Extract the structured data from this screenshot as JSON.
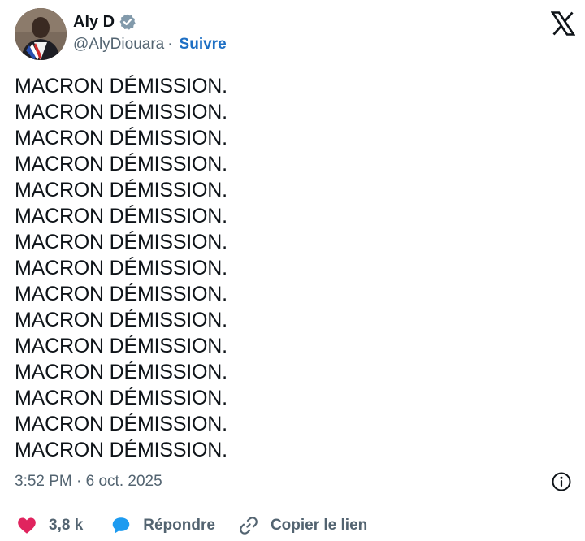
{
  "author": {
    "display_name": "Aly D",
    "handle": "@AlyDiouara",
    "separator": "·",
    "follow_label": "Suivre"
  },
  "tweet": {
    "lines": [
      "MACRON DÉMISSION.",
      "MACRON DÉMISSION.",
      "MACRON DÉMISSION.",
      "MACRON DÉMISSION.",
      "MACRON DÉMISSION.",
      "MACRON DÉMISSION.",
      "MACRON DÉMISSION.",
      "MACRON DÉMISSION.",
      "MACRON DÉMISSION.",
      "MACRON DÉMISSION.",
      "MACRON DÉMISSION.",
      "MACRON DÉMISSION.",
      "MACRON DÉMISSION.",
      "MACRON DÉMISSION.",
      "MACRON DÉMISSION."
    ],
    "timestamp": "3:52 PM · 6 oct. 2025"
  },
  "actions": {
    "like_count": "3,8 k",
    "reply_label": "Répondre",
    "copy_link_label": "Copier le lien"
  },
  "icons": {
    "verified": "verified-badge-icon",
    "logo": "x-logo-icon",
    "info": "info-icon",
    "like": "heart-icon",
    "reply": "speech-bubble-icon",
    "link": "link-icon"
  },
  "colors": {
    "text": "#0f1419",
    "muted": "#536471",
    "follow": "#1d6fc4",
    "heart": "#e0245e",
    "reply": "#1d9bf0",
    "verified": "#829aab"
  }
}
